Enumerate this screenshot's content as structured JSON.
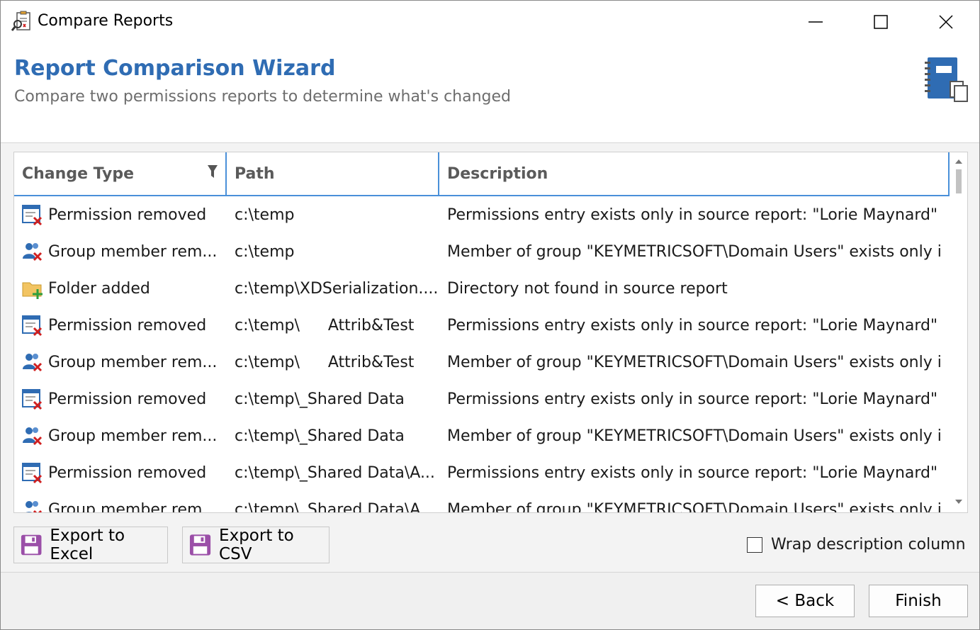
{
  "window": {
    "title": "Compare Reports",
    "icon": "compare-reports-icon",
    "controls": [
      "minimize-icon",
      "maximize-icon",
      "close-icon"
    ]
  },
  "header": {
    "title": "Report Comparison Wizard",
    "subtitle": "Compare two permissions reports to determine what's changed",
    "icon": "report-notebook-icon"
  },
  "grid": {
    "columns": {
      "change_type": "Change Type",
      "path": "Path",
      "description": "Description"
    },
    "filter_icon": "filter-icon",
    "rows": [
      {
        "icon": "permission-removed-icon",
        "change_type": "Permission removed",
        "path": "c:\\temp",
        "path_extra": "",
        "description": "Permissions entry exists only in source report: \"Lorie Maynard\" -..."
      },
      {
        "icon": "group-member-removed-icon",
        "change_type": "Group member rem...",
        "path": "c:\\temp",
        "path_extra": "",
        "description": "Member of group \"KEYMETRICSOFT\\Domain Users\" exists only i..."
      },
      {
        "icon": "folder-added-icon",
        "change_type": "Folder added",
        "path": "c:\\temp\\XDSerialization....",
        "path_extra": "",
        "description": "Directory not found in source report"
      },
      {
        "icon": "permission-removed-icon",
        "change_type": "Permission removed",
        "path": "c:\\temp\\",
        "path_extra": "Attrib&Test",
        "description": "Permissions entry exists only in source report: \"Lorie Maynard\" -..."
      },
      {
        "icon": "group-member-removed-icon",
        "change_type": "Group member rem...",
        "path": "c:\\temp\\",
        "path_extra": "Attrib&Test",
        "description": "Member of group \"KEYMETRICSOFT\\Domain Users\" exists only i..."
      },
      {
        "icon": "permission-removed-icon",
        "change_type": "Permission removed",
        "path": "c:\\temp\\_Shared Data",
        "path_extra": "",
        "description": "Permissions entry exists only in source report: \"Lorie Maynard\" -..."
      },
      {
        "icon": "group-member-removed-icon",
        "change_type": "Group member rem...",
        "path": "c:\\temp\\_Shared Data",
        "path_extra": "",
        "description": "Member of group \"KEYMETRICSOFT\\Domain Users\" exists only i..."
      },
      {
        "icon": "permission-removed-icon",
        "change_type": "Permission removed",
        "path": "c:\\temp\\_Shared Data\\A...",
        "path_extra": "",
        "description": "Permissions entry exists only in source report: \"Lorie Maynard\" -..."
      },
      {
        "icon": "group-member-removed-icon",
        "change_type": "Group member rem...",
        "path": "c:\\temp\\_Shared Data\\A...",
        "path_extra": "",
        "description": "Member of group \"KEYMETRICSOFT\\Domain Users\" exists only i..."
      }
    ]
  },
  "actions": {
    "export_excel": "Export to Excel",
    "export_csv": "Export to CSV",
    "wrap_description": "Wrap description column",
    "wrap_checked": false
  },
  "footer": {
    "back": "< Back",
    "finish": "Finish"
  },
  "colors": {
    "accent": "#2f6cb3",
    "grid_header_border": "#4a90d9"
  }
}
